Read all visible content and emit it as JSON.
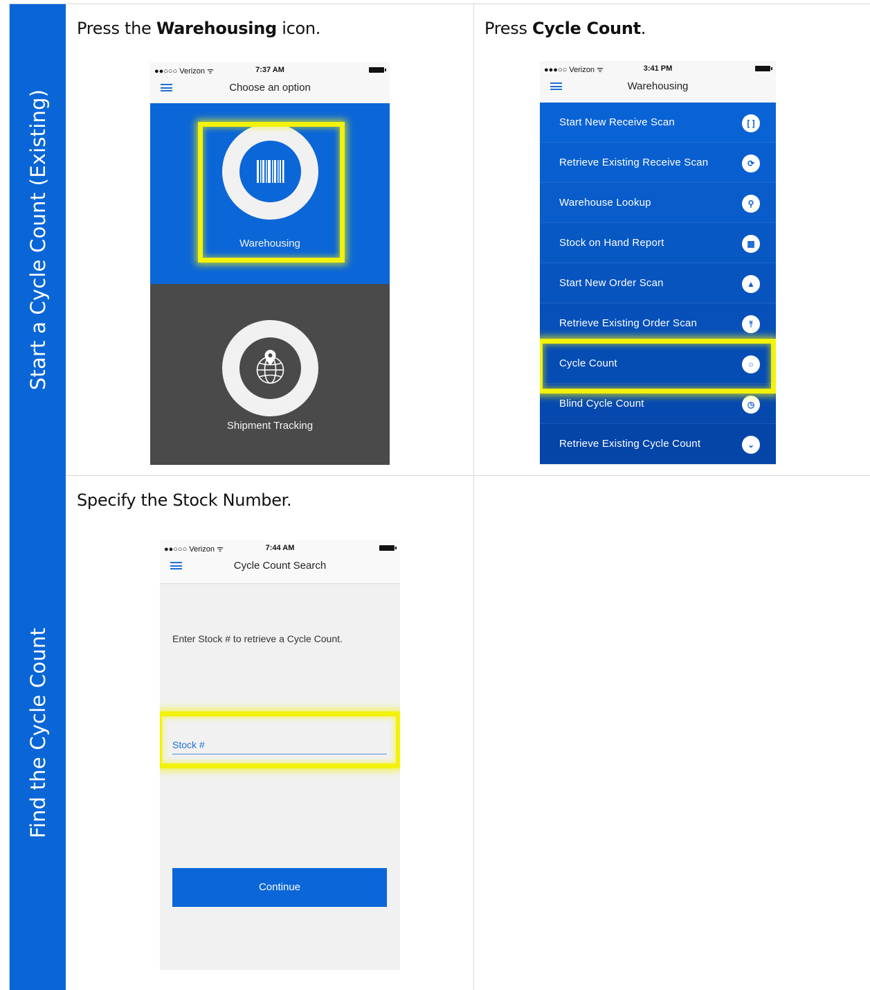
{
  "rows": [
    {
      "side_label": "Start a Cycle Count (Existing)"
    },
    {
      "side_label": "Find the Cycle Count"
    }
  ],
  "step1": {
    "instruction_pre": "Press the ",
    "instruction_bold": "Warehousing",
    "instruction_post": " icon.",
    "phone": {
      "carrier": "●●○○○ Verizon ᯤ",
      "time": "7:37 AM",
      "title": "Choose an option",
      "tiles": [
        {
          "label": "Warehousing",
          "icon": "barcode-icon"
        },
        {
          "label": "Shipment Tracking",
          "icon": "globe-pin-icon"
        }
      ]
    }
  },
  "step2": {
    "instruction_pre": "Press ",
    "instruction_bold": "Cycle Count",
    "instruction_post": ".",
    "phone": {
      "carrier": "●●●○○ Verizon ᯤ",
      "time": "3:41 PM",
      "title": "Warehousing",
      "items": [
        {
          "label": "Start New Receive Scan",
          "icon": "bracket-icon",
          "glyph": "[ ]"
        },
        {
          "label": "Retrieve Existing Receive Scan",
          "icon": "refresh-icon",
          "glyph": "⟳"
        },
        {
          "label": "Warehouse Lookup",
          "icon": "search-icon",
          "glyph": "⚲"
        },
        {
          "label": "Stock on Hand Report",
          "icon": "grid-icon",
          "glyph": "▦"
        },
        {
          "label": "Start New Order Scan",
          "icon": "arrow-up-icon",
          "glyph": "▲"
        },
        {
          "label": "Retrieve Existing Order Scan",
          "icon": "upload-icon",
          "glyph": "⤒"
        },
        {
          "label": "Cycle Count",
          "icon": "circle-icon",
          "glyph": "○"
        },
        {
          "label": "Blind Cycle Count",
          "icon": "clock-icon",
          "glyph": "◷"
        },
        {
          "label": "Retrieve Existing Cycle Count",
          "icon": "chevron-circle-icon",
          "glyph": "⌄"
        }
      ],
      "colors": {
        "top": "#0a63d4",
        "bottom": "#0545a8",
        "highlight": "#f2f20a"
      }
    }
  },
  "step3": {
    "instruction": "Specify the Stock Number.",
    "phone": {
      "carrier": "●●○○○ Verizon ᯤ",
      "time": "7:44 AM",
      "title": "Cycle Count Search",
      "prompt": "Enter Stock # to retrieve a Cycle Count.",
      "field_placeholder": "Stock #",
      "button_label": "Continue"
    }
  }
}
